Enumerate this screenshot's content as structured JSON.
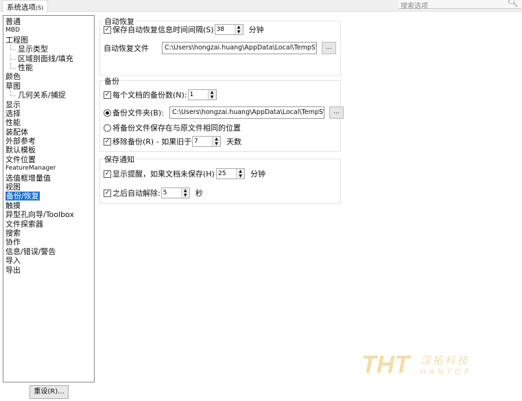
{
  "tab": {
    "label": "系统选项",
    "shortcut": "(S)"
  },
  "search": {
    "placeholder": "搜索选项"
  },
  "tree": [
    {
      "label": "普通",
      "level": 0
    },
    {
      "label": "MBD",
      "level": 0,
      "small": true
    },
    {
      "label": "工程图",
      "level": 0
    },
    {
      "label": "显示类型",
      "level": 1
    },
    {
      "label": "区域剖面线/填充",
      "level": 1
    },
    {
      "label": "性能",
      "level": 1
    },
    {
      "label": "颜色",
      "level": 0
    },
    {
      "label": "草图",
      "level": 0
    },
    {
      "label": "几何关系/捕捉",
      "level": 1
    },
    {
      "label": "显示",
      "level": 0
    },
    {
      "label": "选择",
      "level": 0
    },
    {
      "label": "性能",
      "level": 0
    },
    {
      "label": "装配体",
      "level": 0
    },
    {
      "label": "外部参考",
      "level": 0
    },
    {
      "label": "默认模板",
      "level": 0
    },
    {
      "label": "文件位置",
      "level": 0
    },
    {
      "label": "FeatureManager",
      "level": 0,
      "small": true
    },
    {
      "label": "选值框增量值",
      "level": 0
    },
    {
      "label": "视图",
      "level": 0
    },
    {
      "label": "备份/恢复",
      "level": 0,
      "selected": true
    },
    {
      "label": "触摸",
      "level": 0
    },
    {
      "label": "异型孔向导/Toolbox",
      "level": 0
    },
    {
      "label": "文件探索器",
      "level": 0
    },
    {
      "label": "搜索",
      "level": 0
    },
    {
      "label": "协作",
      "level": 0
    },
    {
      "label": "信息/错误/警告",
      "level": 0
    },
    {
      "label": "导入",
      "level": 0
    },
    {
      "label": "导出",
      "level": 0
    }
  ],
  "reset_label": "重设(R)...",
  "autorecover": {
    "title": "自动恢复",
    "save_label": "保存自动恢复信息时间间隔(S)",
    "interval": "38",
    "unit": "分钟",
    "file_label": "自动恢复文件",
    "path": "C:\\Users\\hongzai.huang\\AppData\\Local\\TempSW备份目",
    "browse": "..."
  },
  "backup": {
    "title": "备份",
    "count_label": "每个文档的备份数(N):",
    "count": "1",
    "folder_label": "备份文件夹(B):",
    "path": "C:\\Users\\hongzai.huang\\AppData\\Local\\TempSW备份目",
    "browse": "...",
    "same_label": "将备份文件保存在与原文件相同的位置",
    "remove_label": "移除备份(R) - 如果旧于",
    "days": "7",
    "days_unit": "天数"
  },
  "notice": {
    "title": "保存通知",
    "remind_label": "显示提醒，如果文档未保存(H)",
    "minutes": "25",
    "minutes_unit": "分钟",
    "dismiss_label": "之后自动解除:",
    "seconds": "5",
    "seconds_unit": "秒"
  },
  "watermark": {
    "logo": "THT",
    "cn": "汉拓科技",
    "en": "HANTOP"
  }
}
